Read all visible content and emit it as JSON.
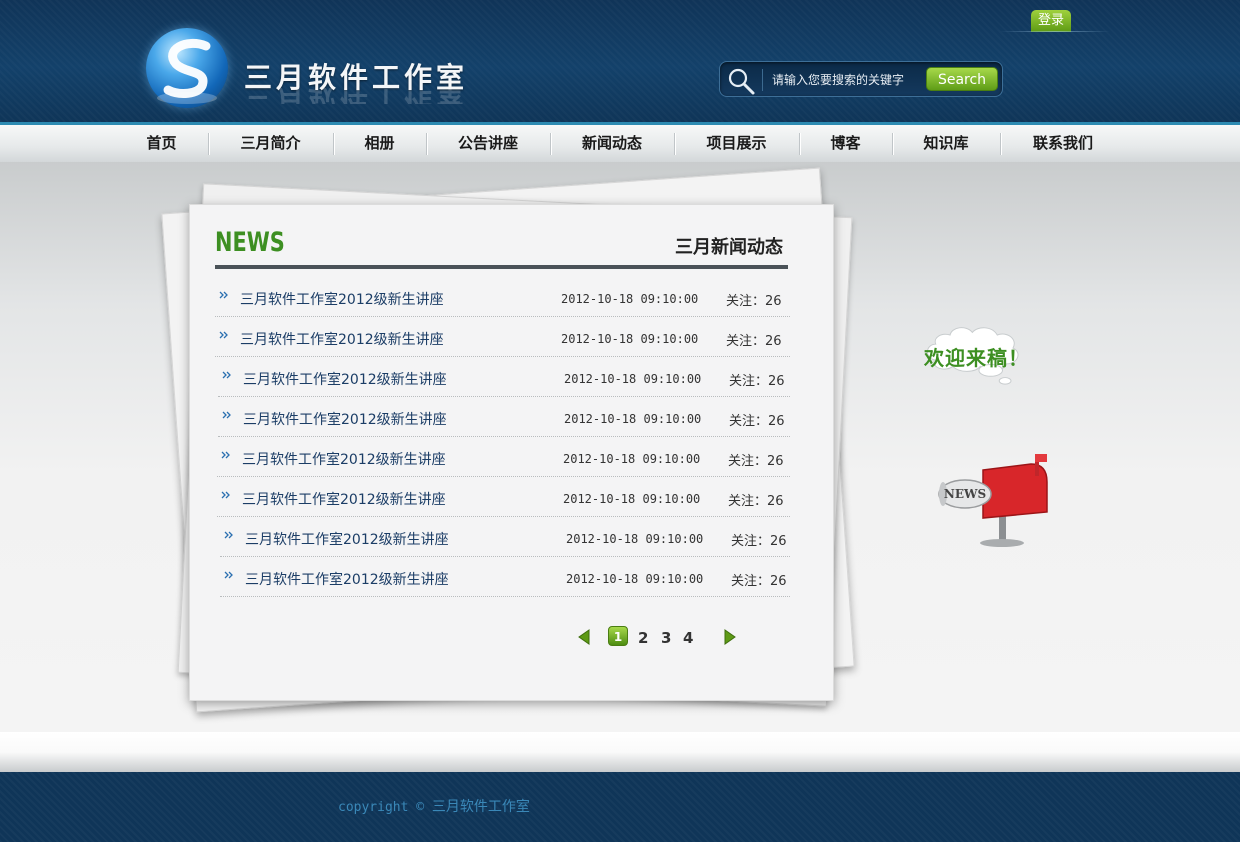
{
  "header": {
    "site_title": "三月软件工作室",
    "login_label": "登录",
    "search": {
      "placeholder": "请输入您要搜索的关键字",
      "button_label": "Search"
    }
  },
  "nav": {
    "items": [
      {
        "label": "首页",
        "width": 93
      },
      {
        "label": "三月简介",
        "width": 125
      },
      {
        "label": "相册",
        "width": 93
      },
      {
        "label": "公告讲座",
        "width": 124
      },
      {
        "label": "新闻动态",
        "width": 124
      },
      {
        "label": "项目展示",
        "width": 125
      },
      {
        "label": "博客",
        "width": 93
      },
      {
        "label": "知识库",
        "width": 108
      },
      {
        "label": "联系我们",
        "width": 126
      }
    ]
  },
  "news": {
    "heading": "NEWS",
    "subheading": "三月新闻动态",
    "rows": [
      {
        "title": "三月软件工作室2012级新生讲座",
        "datetime": "2012-10-18 09:10:00",
        "follow": "关注：26"
      },
      {
        "title": "三月软件工作室2012级新生讲座",
        "datetime": "2012-10-18 09:10:00",
        "follow": "关注：26"
      },
      {
        "title": "三月软件工作室2012级新生讲座",
        "datetime": "2012-10-18 09:10:00",
        "follow": "关注：26"
      },
      {
        "title": "三月软件工作室2012级新生讲座",
        "datetime": "2012-10-18 09:10:00",
        "follow": "关注：26"
      },
      {
        "title": "三月软件工作室2012级新生讲座",
        "datetime": "2012-10-18 09:10:00",
        "follow": "关注：26"
      },
      {
        "title": "三月软件工作室2012级新生讲座",
        "datetime": "2012-10-18 09:10:00",
        "follow": "关注：26"
      },
      {
        "title": "三月软件工作室2012级新生讲座",
        "datetime": "2012-10-18 09:10:00",
        "follow": "关注：26"
      },
      {
        "title": "三月软件工作室2012级新生讲座",
        "datetime": "2012-10-18 09:10:00",
        "follow": "关注：26"
      }
    ],
    "pager": {
      "current": "1",
      "pages": [
        "2",
        "3",
        "4"
      ]
    }
  },
  "side": {
    "welcome_text": "欢迎来稿！",
    "mailbox_label": "NEWS"
  },
  "footer": {
    "copyright_prefix": "copyright © ",
    "org": "三月软件工作室"
  },
  "colors": {
    "brand_dark": "#0f3558",
    "accent_green": "#3d8f22",
    "link_blue": "#1b3d66"
  }
}
